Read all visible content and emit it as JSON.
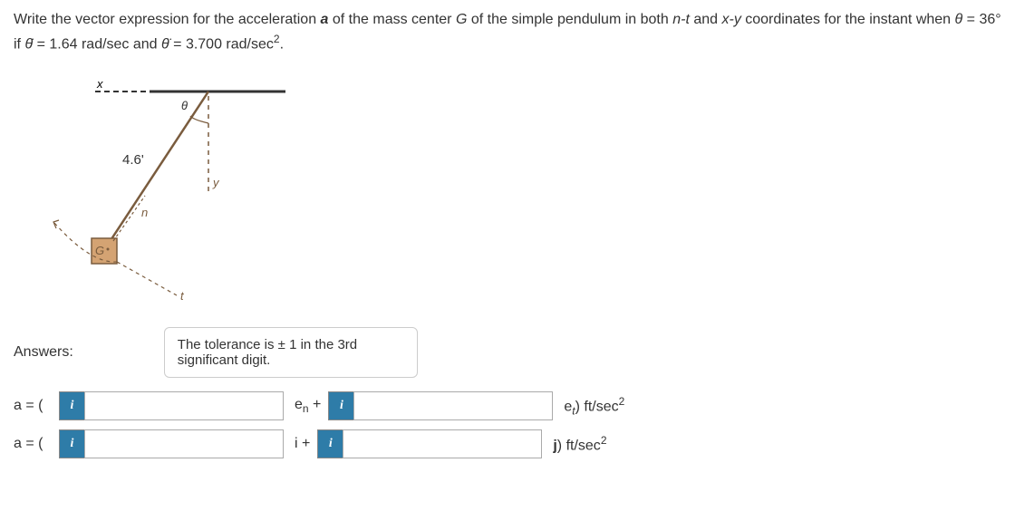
{
  "question": {
    "part1": "Write the vector expression for the acceleration ",
    "bold1": "a",
    "part2": " of the mass center ",
    "italic1": "G",
    "part3": " of the simple pendulum in both ",
    "italic2": "n-t",
    "part4": " and ",
    "italic3": "x-y",
    "part5": " coordinates for the instant when ",
    "italic4": "θ",
    "part6": " = 36° if ",
    "italic5": "θ̇",
    "part7": " = 1.64 rad/sec and ",
    "italic6": "θ̈",
    "part8": " = 3.700 rad/sec",
    "sup1": "2",
    "part9": "."
  },
  "diagram": {
    "x_label": "x",
    "theta_label": "θ",
    "length_label": "4.6'",
    "y_label": "y",
    "n_label": "n",
    "g_label": "G",
    "t_label": "t"
  },
  "answers_label": "Answers:",
  "tolerance": {
    "line1": "The tolerance is ± 1 in the 3rd",
    "line2": "significant digit."
  },
  "row1": {
    "prefix": "a = (",
    "connector": "eₙ +",
    "unit_prefix": "e",
    "unit_sub": "t",
    "unit_suffix": ") ft/sec",
    "unit_sup": "2"
  },
  "row2": {
    "prefix": "a = (",
    "connector": "i +",
    "unit_prefix": "j",
    "unit_suffix": ") ft/sec",
    "unit_sup": "2"
  },
  "info_icon": "i"
}
